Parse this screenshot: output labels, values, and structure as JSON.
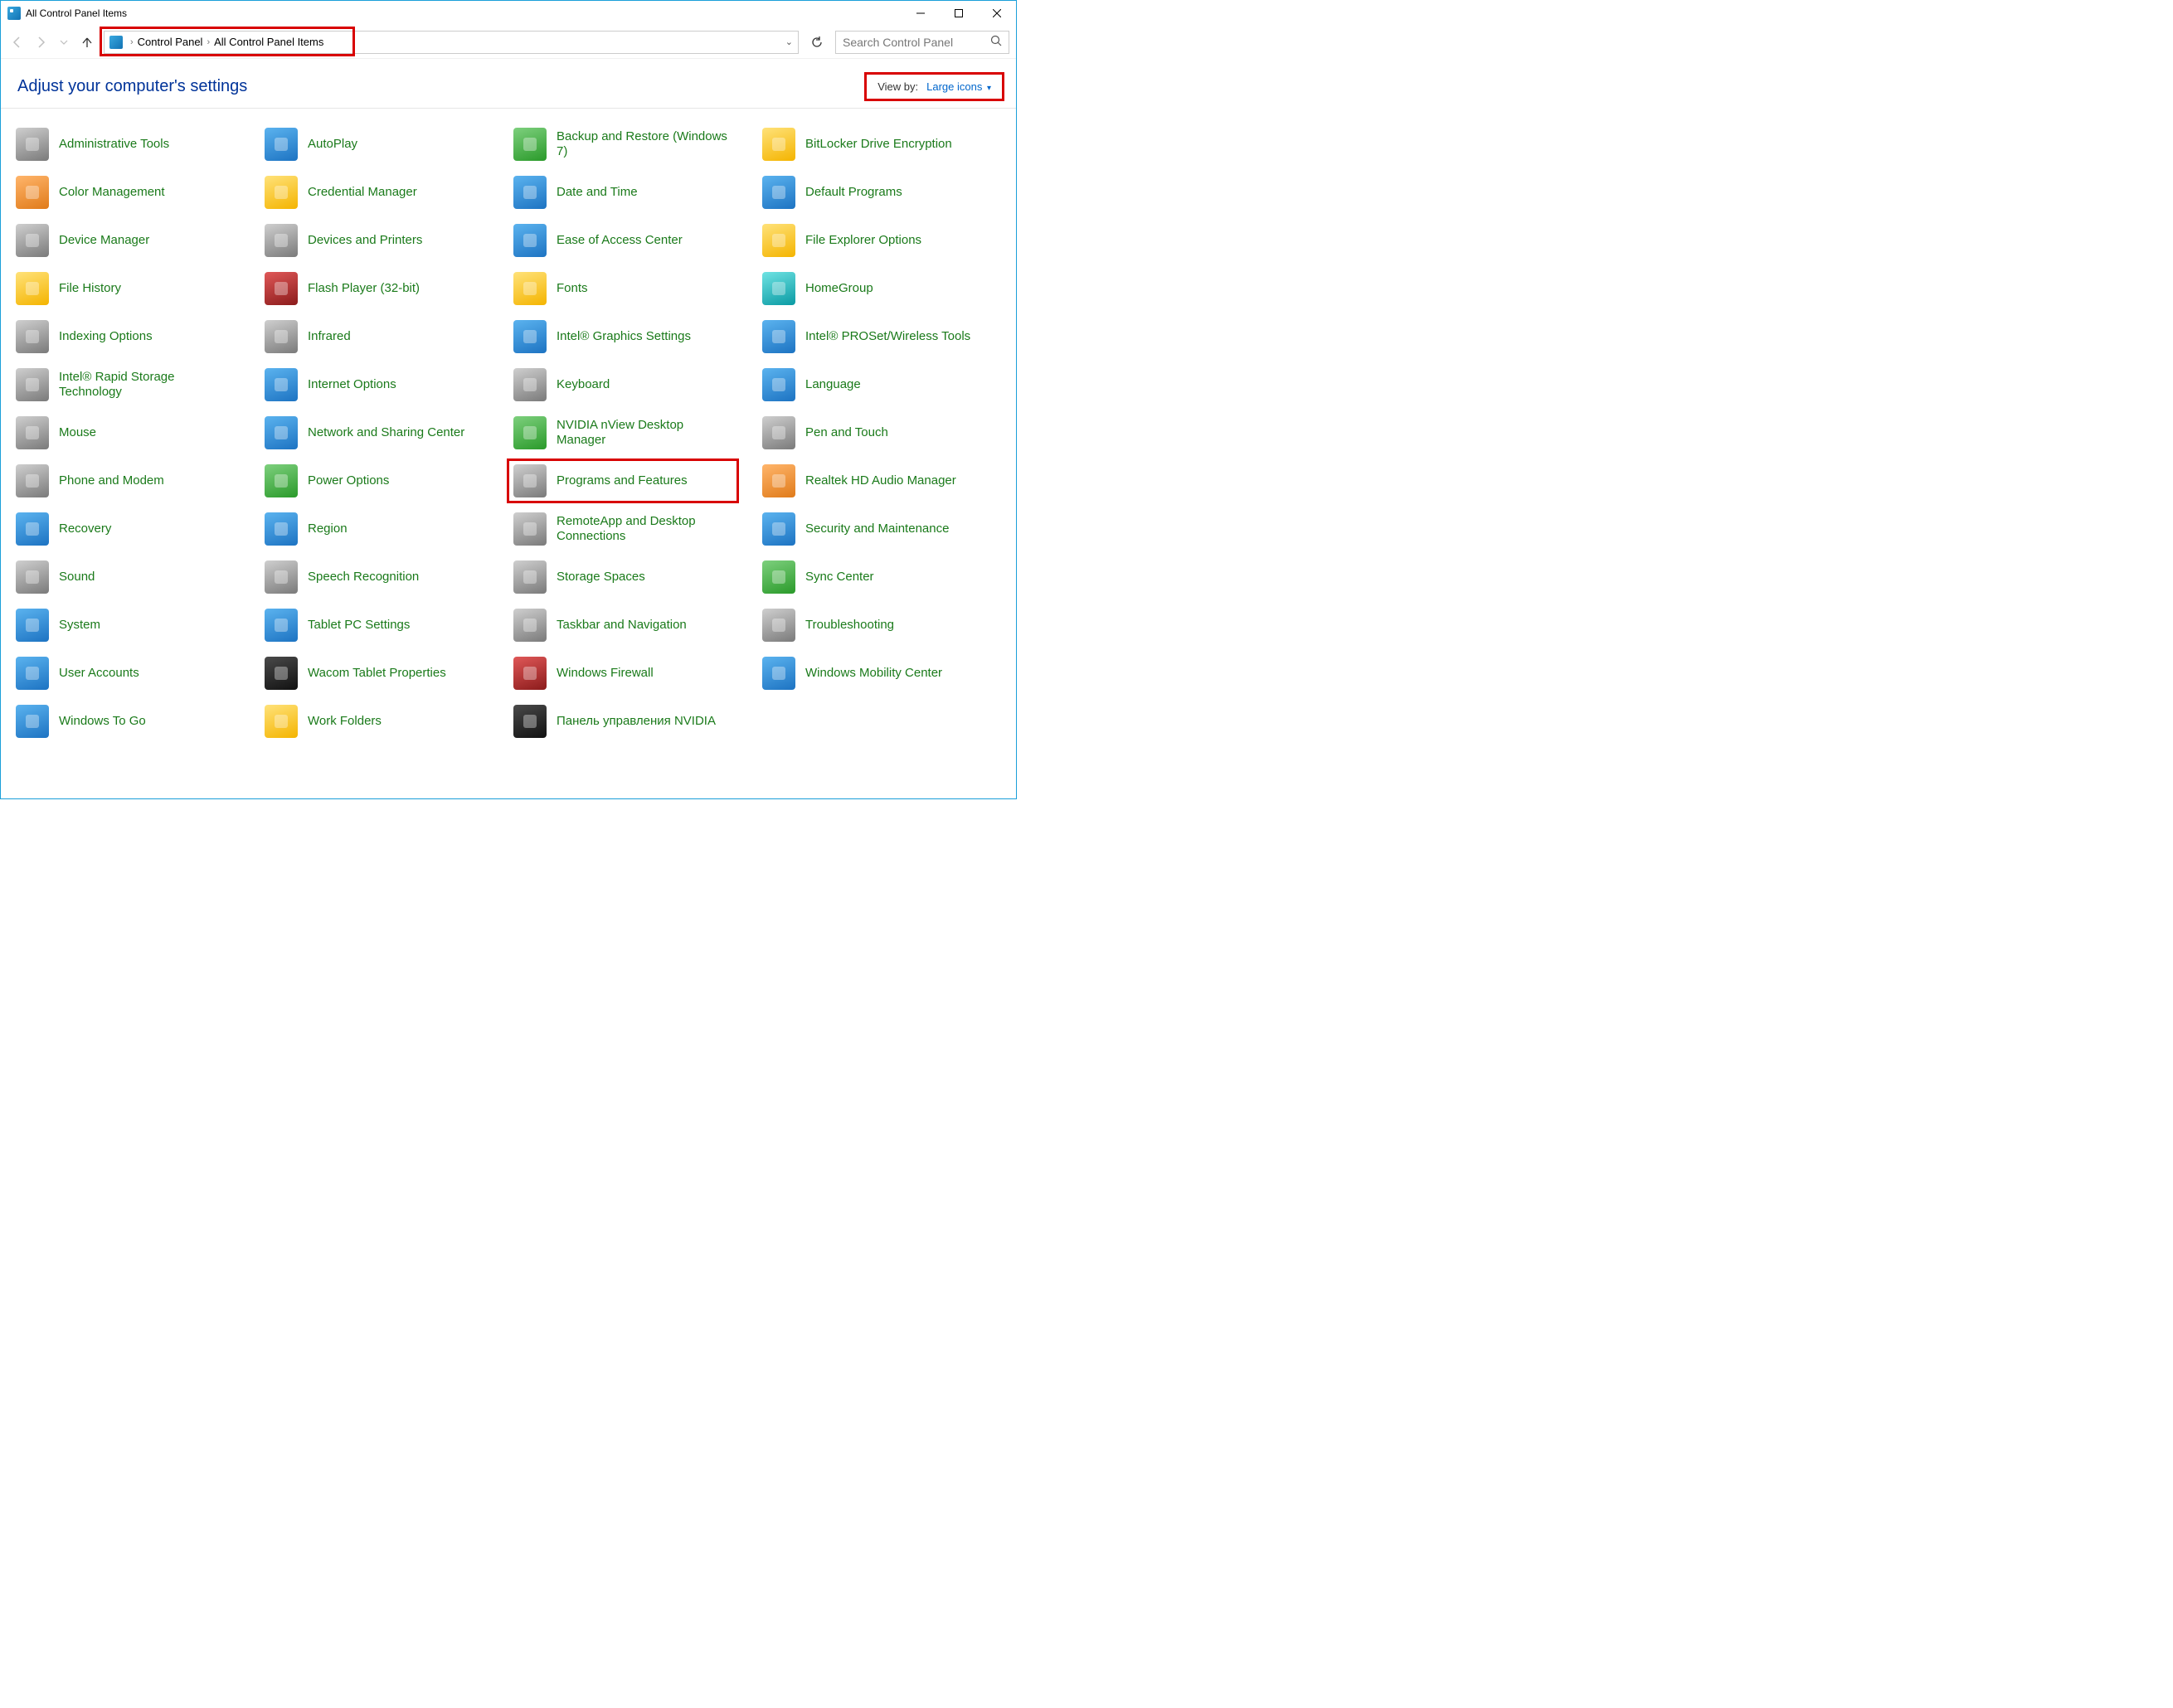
{
  "window": {
    "title": "All Control Panel Items"
  },
  "breadcrumb": {
    "root": "Control Panel",
    "current": "All Control Panel Items"
  },
  "search": {
    "placeholder": "Search Control Panel"
  },
  "header": {
    "heading": "Adjust your computer's settings",
    "viewby_label": "View by:",
    "viewby_value": "Large icons"
  },
  "items": [
    {
      "label": "Administrative Tools",
      "icon": "tools-icon",
      "color": "c-grey"
    },
    {
      "label": "AutoPlay",
      "icon": "autoplay-icon",
      "color": "c-blue"
    },
    {
      "label": "Backup and Restore (Windows 7)",
      "icon": "backup-icon",
      "color": "c-green"
    },
    {
      "label": "BitLocker Drive Encryption",
      "icon": "lock-icon",
      "color": "c-yellow"
    },
    {
      "label": "Color Management",
      "icon": "color-icon",
      "color": "c-orange"
    },
    {
      "label": "Credential Manager",
      "icon": "vault-icon",
      "color": "c-yellow"
    },
    {
      "label": "Date and Time",
      "icon": "clock-icon",
      "color": "c-blue"
    },
    {
      "label": "Default Programs",
      "icon": "defaults-icon",
      "color": "c-blue"
    },
    {
      "label": "Device Manager",
      "icon": "device-icon",
      "color": "c-grey"
    },
    {
      "label": "Devices and Printers",
      "icon": "printer-icon",
      "color": "c-grey"
    },
    {
      "label": "Ease of Access Center",
      "icon": "ease-icon",
      "color": "c-blue"
    },
    {
      "label": "File Explorer Options",
      "icon": "folder-options-icon",
      "color": "c-yellow"
    },
    {
      "label": "File History",
      "icon": "history-icon",
      "color": "c-yellow"
    },
    {
      "label": "Flash Player (32-bit)",
      "icon": "flash-icon",
      "color": "c-red"
    },
    {
      "label": "Fonts",
      "icon": "fonts-icon",
      "color": "c-yellow"
    },
    {
      "label": "HomeGroup",
      "icon": "homegroup-icon",
      "color": "c-cyan"
    },
    {
      "label": "Indexing Options",
      "icon": "index-icon",
      "color": "c-grey"
    },
    {
      "label": "Infrared",
      "icon": "infrared-icon",
      "color": "c-grey"
    },
    {
      "label": "Intel® Graphics Settings",
      "icon": "intel-graphics-icon",
      "color": "c-blue"
    },
    {
      "label": "Intel® PROSet/Wireless Tools",
      "icon": "wifi-icon",
      "color": "c-blue"
    },
    {
      "label": "Intel® Rapid Storage Technology",
      "icon": "storage-icon",
      "color": "c-grey"
    },
    {
      "label": "Internet Options",
      "icon": "globe-icon",
      "color": "c-blue"
    },
    {
      "label": "Keyboard",
      "icon": "keyboard-icon",
      "color": "c-grey"
    },
    {
      "label": "Language",
      "icon": "language-icon",
      "color": "c-blue"
    },
    {
      "label": "Mouse",
      "icon": "mouse-icon",
      "color": "c-grey"
    },
    {
      "label": "Network and Sharing Center",
      "icon": "network-icon",
      "color": "c-blue"
    },
    {
      "label": "NVIDIA nView Desktop Manager",
      "icon": "nvidia-nview-icon",
      "color": "c-green"
    },
    {
      "label": "Pen and Touch",
      "icon": "pen-icon",
      "color": "c-grey"
    },
    {
      "label": "Phone and Modem",
      "icon": "phone-icon",
      "color": "c-grey"
    },
    {
      "label": "Power Options",
      "icon": "power-icon",
      "color": "c-green"
    },
    {
      "label": "Programs and Features",
      "icon": "programs-icon",
      "color": "c-grey",
      "highlight": true
    },
    {
      "label": "Realtek HD Audio Manager",
      "icon": "realtek-icon",
      "color": "c-orange"
    },
    {
      "label": "Recovery",
      "icon": "recovery-icon",
      "color": "c-blue"
    },
    {
      "label": "Region",
      "icon": "region-icon",
      "color": "c-blue"
    },
    {
      "label": "RemoteApp and Desktop Connections",
      "icon": "remote-icon",
      "color": "c-grey"
    },
    {
      "label": "Security and Maintenance",
      "icon": "security-icon",
      "color": "c-blue"
    },
    {
      "label": "Sound",
      "icon": "sound-icon",
      "color": "c-grey"
    },
    {
      "label": "Speech Recognition",
      "icon": "speech-icon",
      "color": "c-grey"
    },
    {
      "label": "Storage Spaces",
      "icon": "storage-spaces-icon",
      "color": "c-grey"
    },
    {
      "label": "Sync Center",
      "icon": "sync-icon",
      "color": "c-green"
    },
    {
      "label": "System",
      "icon": "system-icon",
      "color": "c-blue"
    },
    {
      "label": "Tablet PC Settings",
      "icon": "tablet-icon",
      "color": "c-blue"
    },
    {
      "label": "Taskbar and Navigation",
      "icon": "taskbar-icon",
      "color": "c-grey"
    },
    {
      "label": "Troubleshooting",
      "icon": "troubleshoot-icon",
      "color": "c-grey"
    },
    {
      "label": "User Accounts",
      "icon": "users-icon",
      "color": "c-blue"
    },
    {
      "label": "Wacom Tablet Properties",
      "icon": "wacom-icon",
      "color": "c-dark"
    },
    {
      "label": "Windows Firewall",
      "icon": "firewall-icon",
      "color": "c-red"
    },
    {
      "label": "Windows Mobility Center",
      "icon": "mobility-icon",
      "color": "c-blue"
    },
    {
      "label": "Windows To Go",
      "icon": "togo-icon",
      "color": "c-blue"
    },
    {
      "label": "Work Folders",
      "icon": "work-folders-icon",
      "color": "c-yellow"
    },
    {
      "label": "Панель управления NVIDIA",
      "icon": "nvidia-panel-icon",
      "color": "c-dark"
    }
  ]
}
